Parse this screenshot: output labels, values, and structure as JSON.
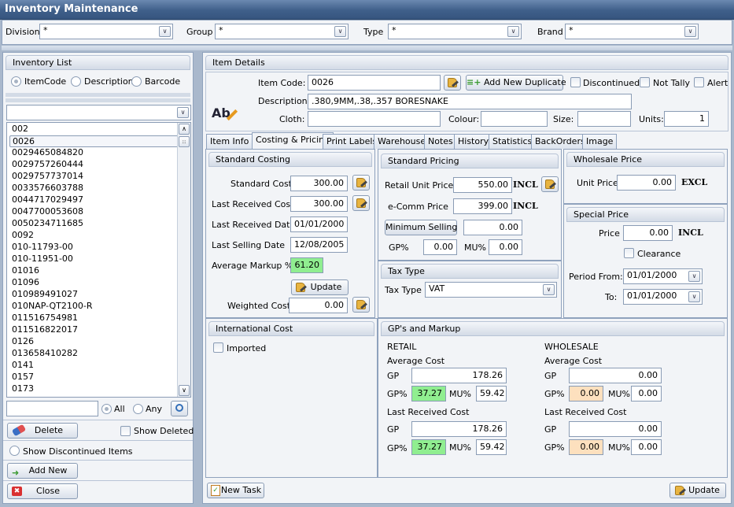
{
  "window": {
    "title": "Inventory Maintenance"
  },
  "filters": {
    "division": {
      "label": "Division",
      "value": "*"
    },
    "group": {
      "label": "Group",
      "value": "*"
    },
    "type": {
      "label": "Type",
      "value": "*"
    },
    "brand": {
      "label": "Brand",
      "value": "*"
    }
  },
  "inventory_list": {
    "title": "Inventory List",
    "search_modes": [
      {
        "label": "ItemCode",
        "selected": true
      },
      {
        "label": "Description",
        "selected": false
      },
      {
        "label": "Barcode",
        "selected": false
      }
    ],
    "search_value": "",
    "items": [
      "002",
      "0026",
      "0029465084820",
      "0029757260444",
      "0029757737014",
      "0033576603788",
      "0044717029497",
      "0047700053608",
      "0050234711685",
      "0092",
      "010-11793-00",
      "010-11951-00",
      "01016",
      "01096",
      "010989491027",
      "010NAP-QT2100-R",
      "011516754981",
      "011516822017",
      "0126",
      "013658410282",
      "0141",
      "0157",
      "0173"
    ],
    "selected_item": "0026",
    "filter_text": "",
    "match_all_label": "All",
    "match_any_label": "Any",
    "delete_label": "Delete",
    "show_deleted_label": "Show Deleted",
    "show_discontinued_label": "Show Discontinued Items",
    "add_new_label": "Add New",
    "close_label": "Close"
  },
  "item_details": {
    "title": "Item Details",
    "item_code_label": "Item Code:",
    "item_code": "0026",
    "add_duplicate_label": "Add New Duplicate",
    "discontinued_label": "Discontinued",
    "not_tally_label": "Not Tally",
    "alert_label": "Alert",
    "description_label": "Description:",
    "description": ".380,9MM,.38,.357 BORESNAKE",
    "cloth_label": "Cloth:",
    "cloth": "",
    "colour_label": "Colour:",
    "colour": "",
    "size_label": "Size:",
    "size": "",
    "units_label": "Units:",
    "units": "1",
    "icon_text": "Ab"
  },
  "tabs": [
    "Item Info",
    "Costing & Pricing",
    "Print Labels",
    "Warehouse",
    "Notes",
    "History",
    "Statistics",
    "BackOrders",
    "Image"
  ],
  "active_tab": "Costing & Pricing",
  "standard_costing": {
    "title": "Standard Costing",
    "standard_cost_label": "Standard Cost",
    "standard_cost": "300.00",
    "last_received_cost_label": "Last Received Cost",
    "last_received_cost": "300.00",
    "last_received_date_label": "Last Received Date",
    "last_received_date": "01/01/2000",
    "last_selling_date_label": "Last Selling Date",
    "last_selling_date": "12/08/2005",
    "average_markup_label": "Average Markup %",
    "average_markup": "61.20",
    "update_label": "Update",
    "weighted_cost_label": "Weighted Cost",
    "weighted_cost": "0.00"
  },
  "standard_pricing": {
    "title": "Standard Pricing",
    "retail_unit_price_label": "Retail Unit Price",
    "retail_unit_price": "550.00",
    "retail_tax": "INCL",
    "ecomm_price_label": "e-Comm Price",
    "ecomm_price": "399.00",
    "ecomm_tax": "INCL",
    "minimum_selling_label": "Minimum Selling",
    "minimum_selling": "0.00",
    "gp_label": "GP%",
    "gp": "0.00",
    "mu_label": "MU%",
    "mu": "0.00"
  },
  "tax_type": {
    "title": "Tax Type",
    "label": "Tax Type",
    "value": "VAT"
  },
  "wholesale_price": {
    "title": "Wholesale Price",
    "unit_price_label": "Unit Price",
    "unit_price": "0.00",
    "tax": "EXCL"
  },
  "special_price": {
    "title": "Special Price",
    "price_label": "Price",
    "price": "0.00",
    "tax": "INCL",
    "clearance_label": "Clearance",
    "period_from_label": "Period From:",
    "period_from": "01/01/2000",
    "to_label": "To:",
    "to": "01/01/2000"
  },
  "international_cost": {
    "title": "International Cost",
    "imported_label": "Imported"
  },
  "gps_markup": {
    "title": "GP's and Markup",
    "retail": {
      "heading": "RETAIL",
      "average_cost_label": "Average Cost",
      "avg_gp_label": "GP",
      "avg_gp": "178.26",
      "avg_gpp_label": "GP%",
      "avg_gpp": "37.27",
      "avg_mu_label": "MU%",
      "avg_mu": "59.42",
      "last_received_label": "Last Received Cost",
      "lr_gp_label": "GP",
      "lr_gp": "178.26",
      "lr_gpp_label": "GP%",
      "lr_gpp": "37.27",
      "lr_mu_label": "MU%",
      "lr_mu": "59.42"
    },
    "wholesale": {
      "heading": "WHOLESALE",
      "average_cost_label": "Average Cost",
      "avg_gp_label": "GP",
      "avg_gp": "0.00",
      "avg_gpp_label": "GP%",
      "avg_gpp": "0.00",
      "avg_mu_label": "MU%",
      "avg_mu": "0.00",
      "last_received_label": "Last Received Cost",
      "lr_gp_label": "GP",
      "lr_gp": "0.00",
      "lr_gpp_label": "GP%",
      "lr_gpp": "0.00",
      "lr_mu_label": "MU%",
      "lr_mu": "0.00"
    }
  },
  "footer": {
    "new_task_label": "New Task",
    "update_label": "Update"
  },
  "colors": {
    "title_bar": "#3f5f8a",
    "good_value": "#90ee90",
    "warn_value": "#fde0be"
  }
}
